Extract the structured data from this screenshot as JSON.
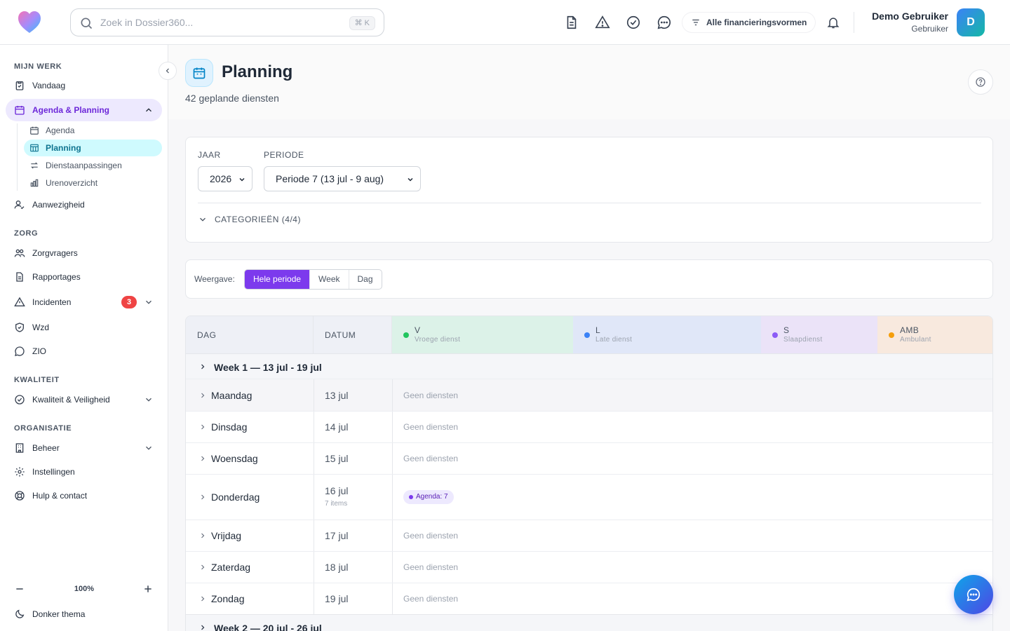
{
  "search": {
    "placeholder": "Zoek in Dossier360...",
    "shortcut": "⌘ K"
  },
  "topbar": {
    "financing_label": "Alle financieringsvormen",
    "user_name": "Demo Gebruiker",
    "user_role": "Gebruiker",
    "avatar_initial": "D"
  },
  "sidebar": {
    "sections": {
      "work": "MIJN WERK",
      "care": "ZORG",
      "quality": "KWALITEIT",
      "org": "ORGANISATIE"
    },
    "items": {
      "today": "Vandaag",
      "agenda_planning": "Agenda & Planning",
      "agenda": "Agenda",
      "planning": "Planning",
      "shift_changes": "Dienstaanpassingen",
      "hours": "Urenoverzicht",
      "attendance": "Aanwezigheid",
      "clients": "Zorgvragers",
      "reports": "Rapportages",
      "incidents": "Incidenten",
      "incidents_badge": "3",
      "wzd": "Wzd",
      "zio": "ZIO",
      "quality_safety": "Kwaliteit & Veiligheid",
      "management": "Beheer",
      "settings": "Instellingen",
      "help": "Hulp & contact"
    },
    "zoom": "100%",
    "dark_theme": "Donker thema"
  },
  "page": {
    "title": "Planning",
    "subtitle": "42 geplande diensten"
  },
  "filters": {
    "year_label": "JAAR",
    "year_value": "2026",
    "period_label": "PERIODE",
    "period_value": "Periode 7 (13 jul - 9 aug)",
    "categories_label": "CATEGORIEËN (4/4)"
  },
  "view": {
    "label": "Weergave:",
    "options": [
      "Hele periode",
      "Week",
      "Dag"
    ],
    "selected": "Hele periode"
  },
  "table": {
    "headers": {
      "day": "DAG",
      "date": "DATUM"
    },
    "shifts": [
      {
        "code": "V",
        "name": "Vroege dienst",
        "color": "#22c55e",
        "bg": "#dcf2e8"
      },
      {
        "code": "L",
        "name": "Late dienst",
        "color": "#3b82f6",
        "bg": "#e0e7f8"
      },
      {
        "code": "S",
        "name": "Slaapdienst",
        "color": "#8b5cf6",
        "bg": "#ebe3f8"
      },
      {
        "code": "AMB",
        "name": "Ambulant",
        "color": "#f59e0b",
        "bg": "#f8e9de"
      }
    ],
    "weeks": [
      {
        "label": "Week 1 — 13 jul - 19 jul",
        "days": [
          {
            "name": "Maandag",
            "date": "13 jul",
            "status": "Geen diensten"
          },
          {
            "name": "Dinsdag",
            "date": "14 jul",
            "status": "Geen diensten"
          },
          {
            "name": "Woensdag",
            "date": "15 jul",
            "status": "Geen diensten"
          },
          {
            "name": "Donderdag",
            "date": "16 jul",
            "items": "7 items",
            "chip": "Agenda: 7"
          },
          {
            "name": "Vrijdag",
            "date": "17 jul",
            "status": "Geen diensten"
          },
          {
            "name": "Zaterdag",
            "date": "18 jul",
            "status": "Geen diensten"
          },
          {
            "name": "Zondag",
            "date": "19 jul",
            "status": "Geen diensten"
          }
        ]
      },
      {
        "label": "Week 2 — 20 jul - 26 jul"
      }
    ]
  }
}
